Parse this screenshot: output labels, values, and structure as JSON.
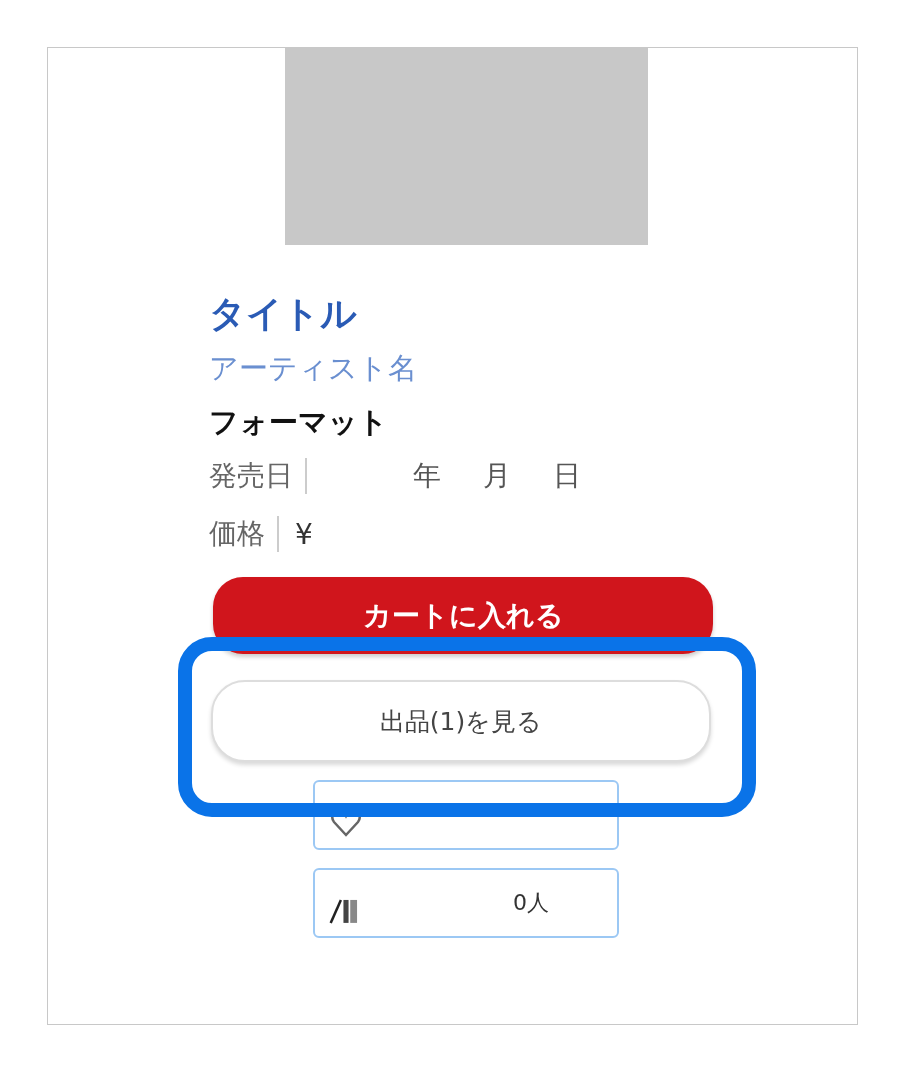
{
  "product": {
    "title": "タイトル",
    "artist": "アーティスト名",
    "format": "フォーマット",
    "release": {
      "label": "発売日",
      "year": "年",
      "month": "月",
      "day": "日"
    },
    "price": {
      "label": "価格",
      "value": "¥"
    }
  },
  "buttons": {
    "cart": "カートに入れる",
    "listings": "出品(1)を見る"
  },
  "counters": [
    {
      "kind": "favorite"
    },
    {
      "kind": "collection",
      "count": "0人"
    }
  ]
}
